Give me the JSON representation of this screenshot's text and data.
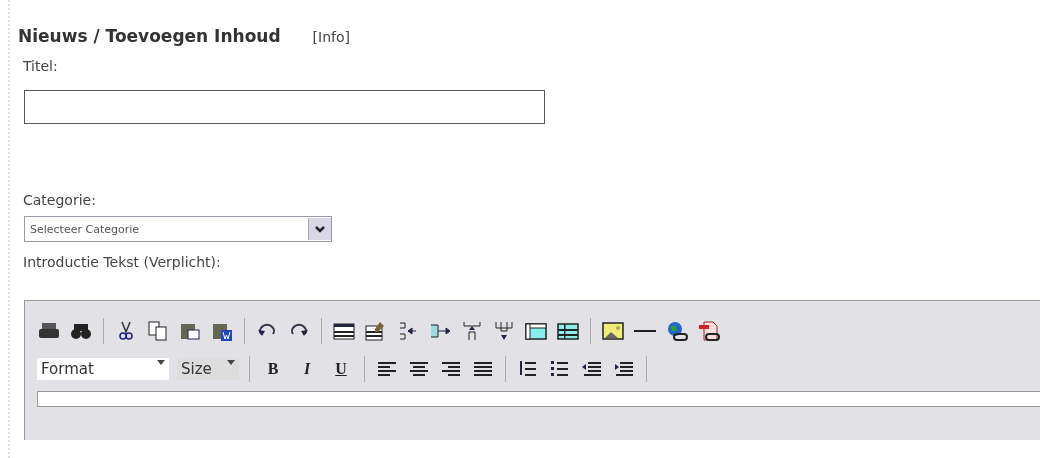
{
  "heading": {
    "title": "Nieuws / Toevoegen  Inhoud",
    "info_link": "[Info]"
  },
  "fields": [
    {
      "label": "Titel:"
    }
  ],
  "category": {
    "label": "Categorie:",
    "value": "Selecteer Categorie"
  },
  "intro": {
    "label": "Introductie Tekst (Verplicht):"
  },
  "editor": {
    "format_select": "Format",
    "size_select": "Size",
    "bold": "B",
    "italic": "I",
    "underline": "U"
  }
}
